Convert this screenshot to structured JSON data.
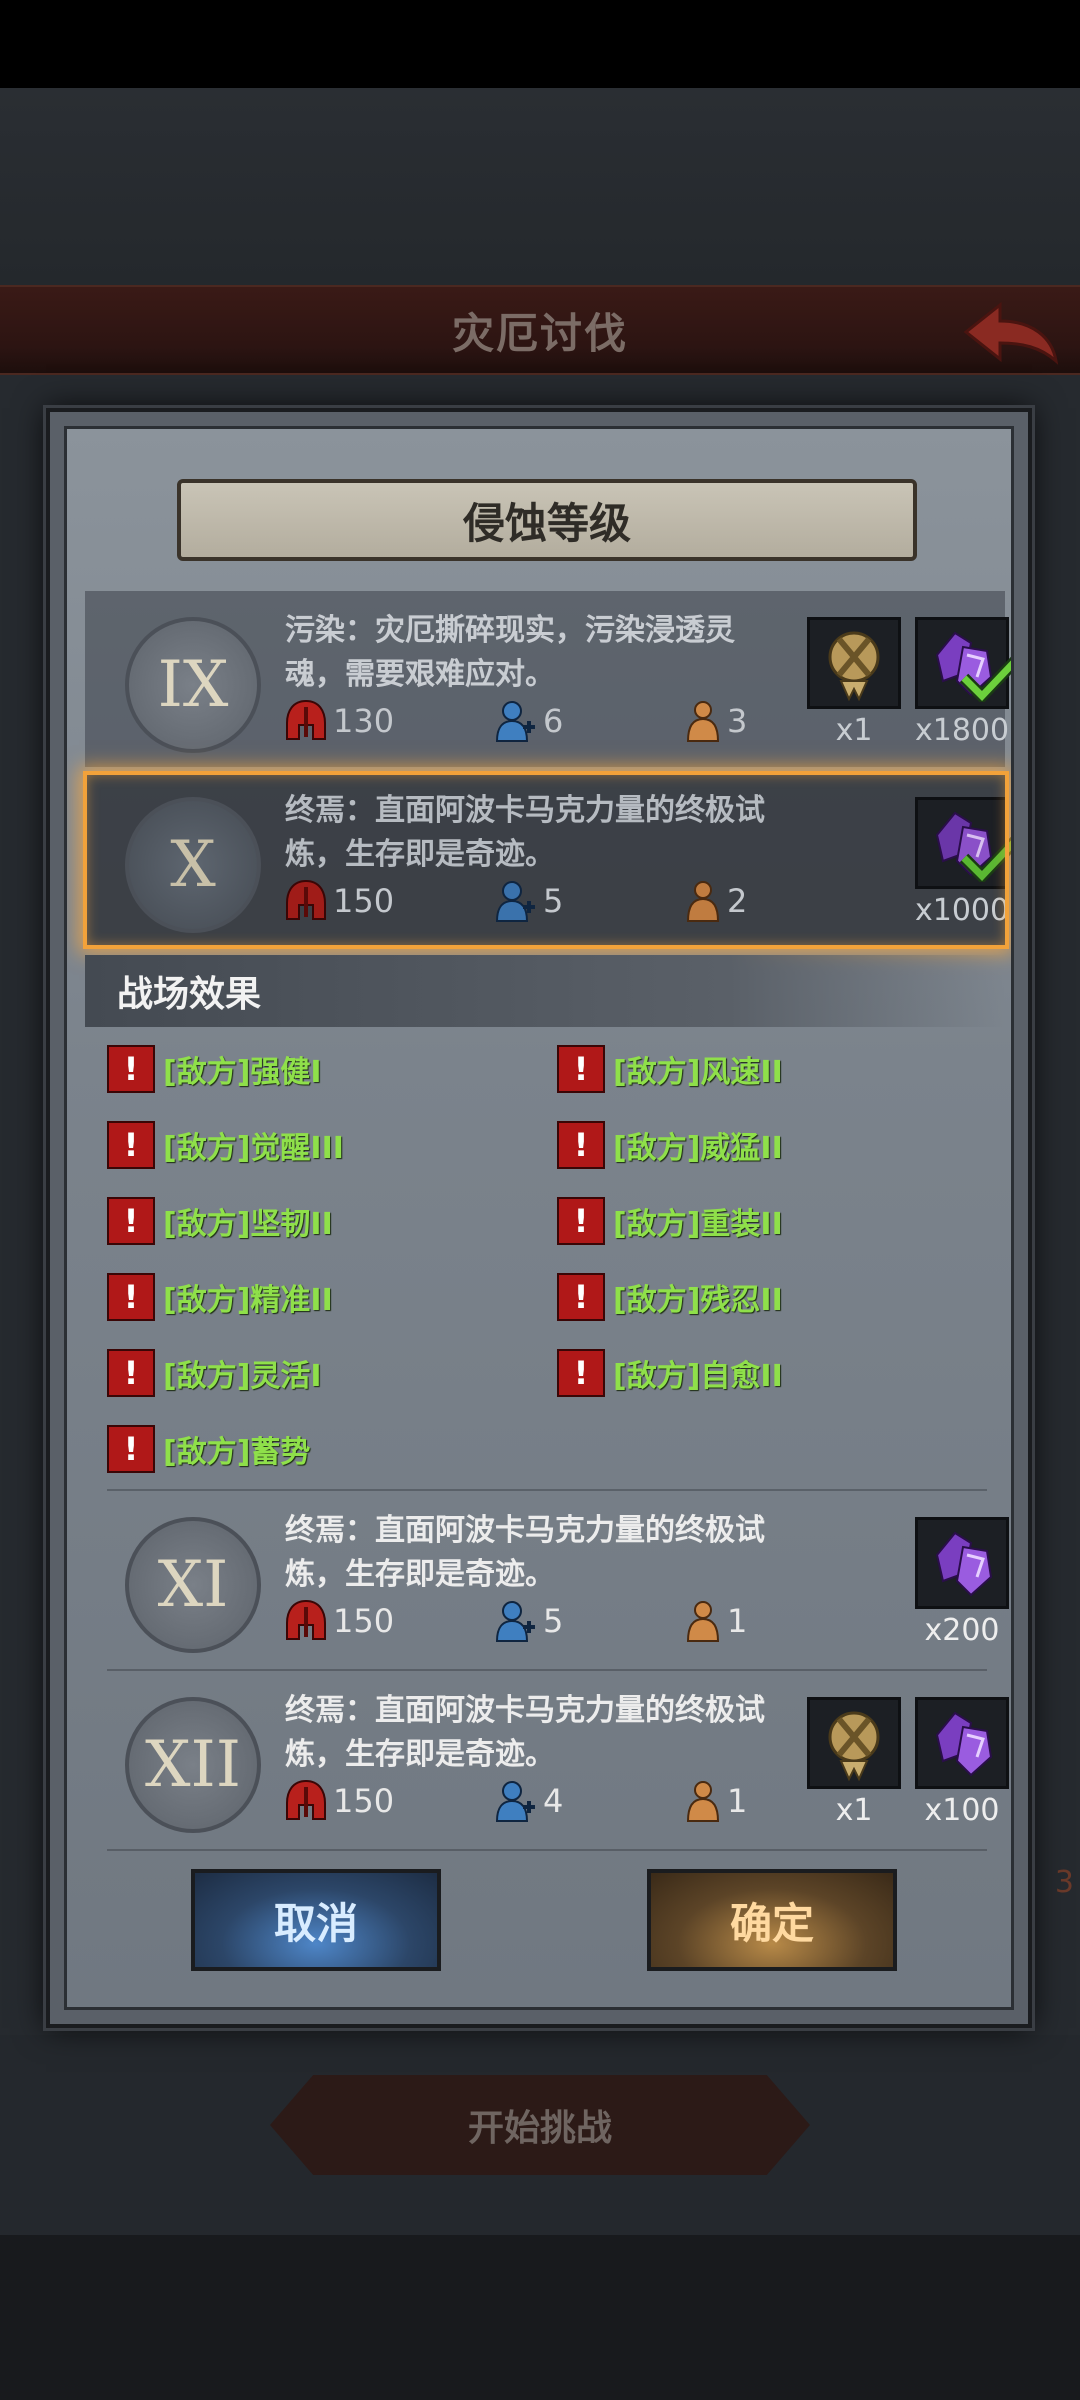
{
  "header": {
    "title": "灾厄讨伐"
  },
  "dialog": {
    "title": "侵蚀等级",
    "tiers": [
      {
        "numeral": "IX",
        "description": "污染：灾厄撕碎现实，污染浸透灵魂，需要艰难应对。",
        "stats": {
          "power": "130",
          "allies": "6",
          "units": "3"
        },
        "rewards": [
          {
            "icon": "guild-badge-icon",
            "qty": "x1"
          },
          {
            "icon": "purple-crystal-icon",
            "qty": "x1800",
            "claimed": true
          }
        ]
      },
      {
        "numeral": "X",
        "description": "终焉：直面阿波卡马克力量的终极试炼，生存即是奇迹。",
        "stats": {
          "power": "150",
          "allies": "5",
          "units": "2"
        },
        "rewards": [
          {
            "icon": "purple-crystal-icon",
            "qty": "x1000",
            "claimed": true
          }
        ],
        "selected": true
      },
      {
        "numeral": "XI",
        "description": "终焉：直面阿波卡马克力量的终极试炼，生存即是奇迹。",
        "stats": {
          "power": "150",
          "allies": "5",
          "units": "1"
        },
        "rewards": [
          {
            "icon": "purple-crystal-icon",
            "qty": "x200"
          }
        ]
      },
      {
        "numeral": "XII",
        "description": "终焉：直面阿波卡马克力量的终极试炼，生存即是奇迹。",
        "stats": {
          "power": "150",
          "allies": "4",
          "units": "1"
        },
        "rewards": [
          {
            "icon": "guild-badge-icon",
            "qty": "x1"
          },
          {
            "icon": "purple-crystal-icon",
            "qty": "x100"
          }
        ]
      }
    ],
    "effects": {
      "heading": "战场效果",
      "items": [
        "[敌方]强健I",
        "[敌方]风速II",
        "[敌方]觉醒III",
        "[敌方]威猛II",
        "[敌方]坚韧II",
        "[敌方]重装II",
        "[敌方]精准II",
        "[敌方]残忍II",
        "[敌方]灵活I",
        "[敌方]自愈II",
        "[敌方]蓄势"
      ]
    },
    "buttons": {
      "cancel": "取消",
      "confirm": "确定"
    }
  },
  "footer": {
    "start_label": "开始挑战",
    "side_number": "3"
  },
  "colors": {
    "effect_text": "#8fe04a",
    "selection": "#f2a23a",
    "warning": "#b01818"
  }
}
